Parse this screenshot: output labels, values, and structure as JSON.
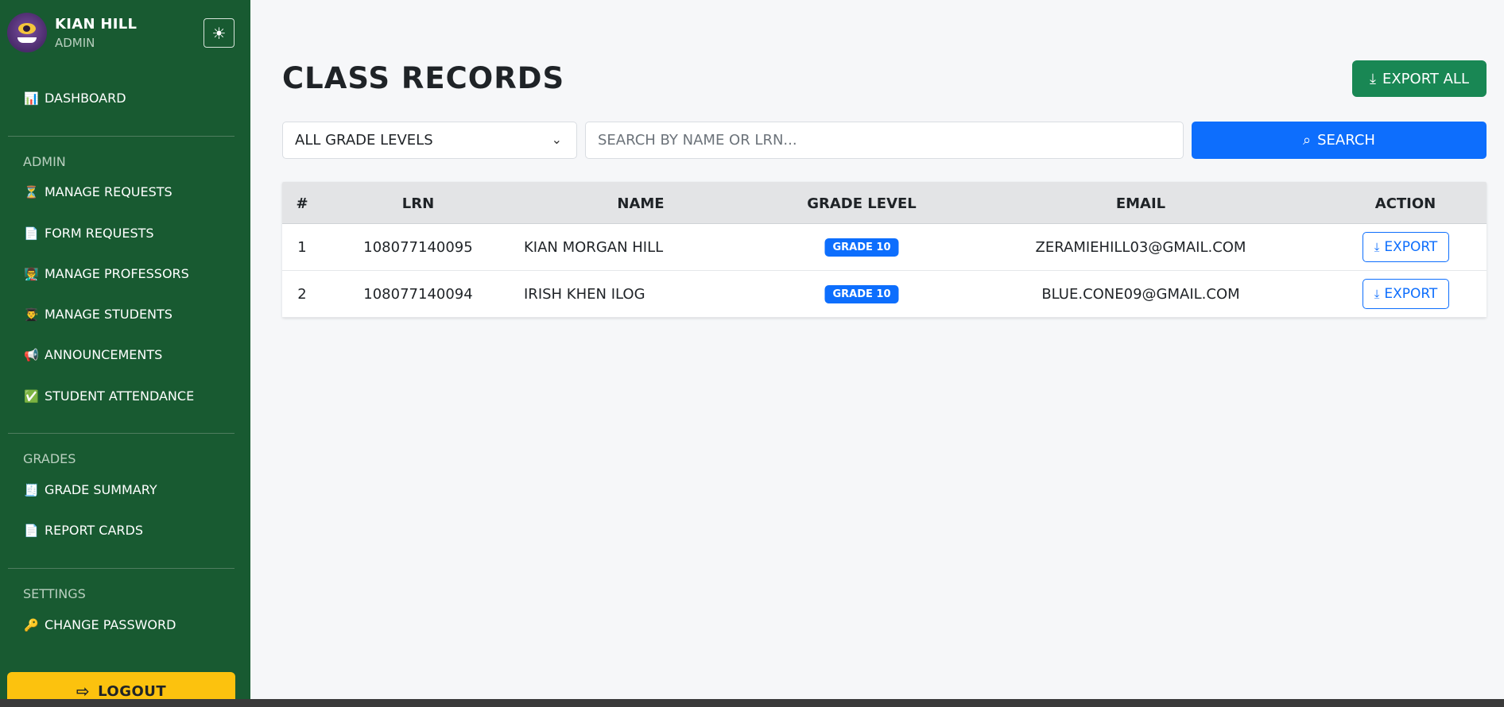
{
  "sidebar": {
    "profile": {
      "name": "KIAN HILL",
      "role": "ADMIN"
    },
    "theme_toggle_icon": "☀",
    "dashboard": {
      "icon": "📊",
      "label": "DASHBOARD"
    },
    "sections": [
      {
        "label": "ADMIN",
        "items": [
          {
            "icon": "⏳",
            "label": "MANAGE REQUESTS"
          },
          {
            "icon": "📄",
            "label": "FORM REQUESTS"
          },
          {
            "icon": "👨‍🏫",
            "label": "MANAGE PROFESSORS"
          },
          {
            "icon": "👨‍🎓",
            "label": "MANAGE STUDENTS"
          },
          {
            "icon": "📢",
            "label": "ANNOUNCEMENTS"
          },
          {
            "icon": "✅",
            "label": "STUDENT ATTENDANCE"
          }
        ]
      },
      {
        "label": "GRADES",
        "items": [
          {
            "icon": "🧾",
            "label": "GRADE SUMMARY"
          },
          {
            "icon": "📄",
            "label": "REPORT CARDS"
          }
        ]
      },
      {
        "label": "SETTINGS",
        "items": [
          {
            "icon": "🔑",
            "label": "CHANGE PASSWORD"
          }
        ]
      }
    ],
    "logout": {
      "icon": "⇨",
      "label": "LOGOUT"
    }
  },
  "main": {
    "title": "CLASS RECORDS",
    "export_all": {
      "icon": "⤓",
      "label": "EXPORT ALL"
    },
    "filter": {
      "selected": "ALL GRADE LEVELS"
    },
    "search": {
      "placeholder": "SEARCH BY NAME OR LRN...",
      "value": ""
    },
    "search_button": {
      "icon": "⌕",
      "label": "SEARCH"
    },
    "table": {
      "columns": [
        "#",
        "LRN",
        "NAME",
        "GRADE LEVEL",
        "EMAIL",
        "ACTION"
      ],
      "rows": [
        {
          "num": "1",
          "lrn": "108077140095",
          "name": "KIAN MORGAN HILL",
          "grade": "GRADE 10",
          "email": "ZERAMIEHILL03@GMAIL.COM",
          "action": "EXPORT"
        },
        {
          "num": "2",
          "lrn": "108077140094",
          "name": "IRISH KHEN ILOG",
          "grade": "GRADE 10",
          "email": "BLUE.CONE09@GMAIL.COM",
          "action": "EXPORT"
        }
      ]
    }
  },
  "colors": {
    "sidebar": "#185a31",
    "primary": "#0d6efd",
    "success": "#198754",
    "warning": "#fcc20e"
  }
}
